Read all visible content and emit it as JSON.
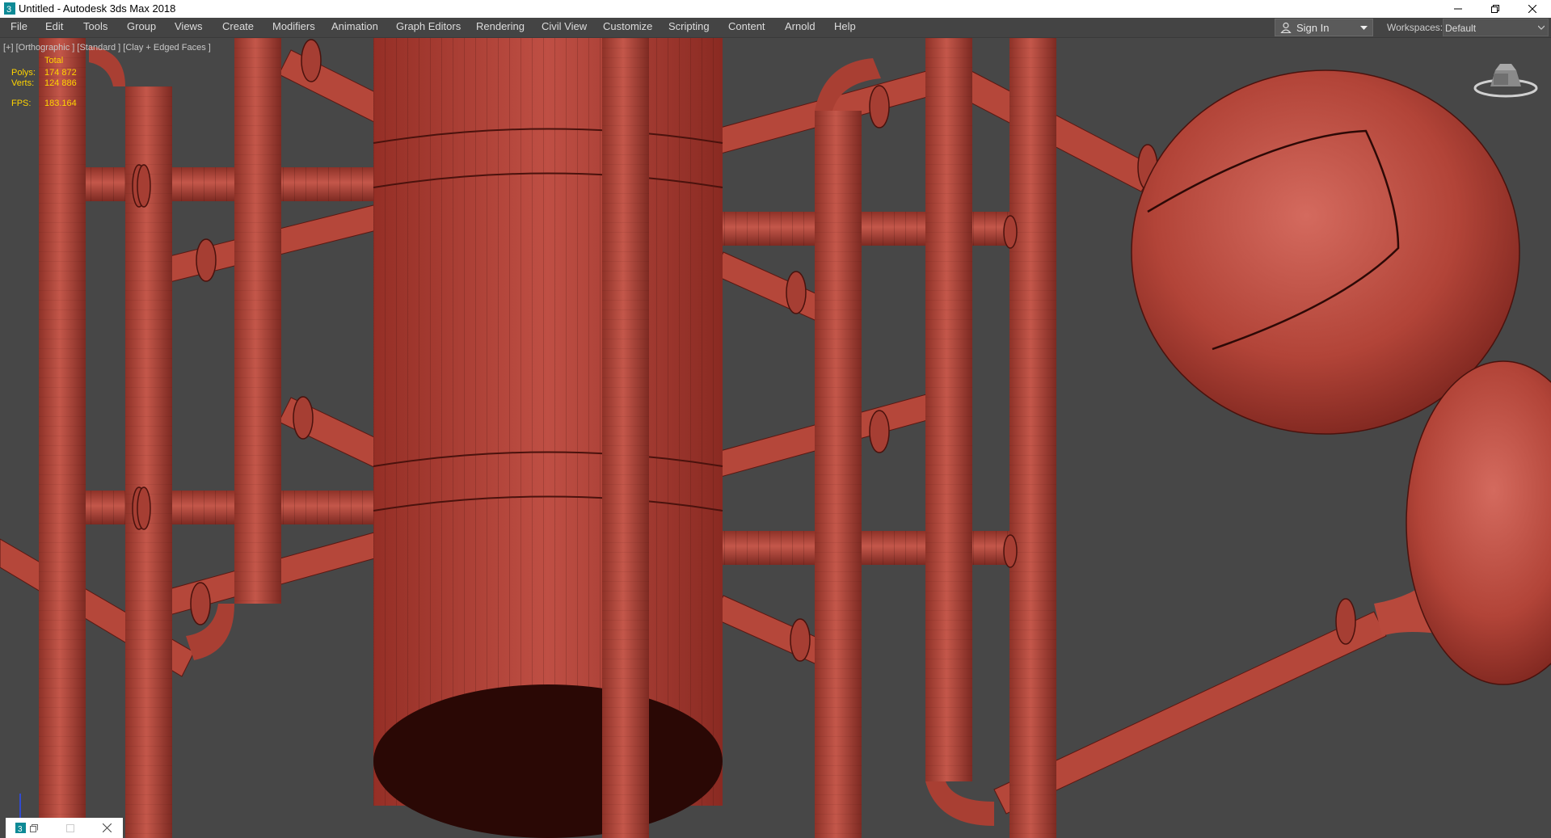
{
  "window": {
    "title": "Untitled - Autodesk 3ds Max 2018",
    "app_icon": "3dsmax-icon",
    "controls": [
      "minimize-icon",
      "restore-icon",
      "close-icon"
    ]
  },
  "menu": [
    {
      "label": "File"
    },
    {
      "label": "Edit"
    },
    {
      "label": "Tools"
    },
    {
      "label": "Group"
    },
    {
      "label": "Views"
    },
    {
      "label": "Create"
    },
    {
      "label": "Modifiers"
    },
    {
      "label": "Animation"
    },
    {
      "label": "Graph Editors"
    },
    {
      "label": "Rendering"
    },
    {
      "label": "Civil View"
    },
    {
      "label": "Customize"
    },
    {
      "label": "Scripting"
    },
    {
      "label": "Content"
    },
    {
      "label": "Arnold"
    },
    {
      "label": "Help"
    }
  ],
  "account": {
    "sign_in_label": "Sign In",
    "icon": "user-icon"
  },
  "workspaces": {
    "label": "Workspaces:",
    "value": "Default"
  },
  "viewport": {
    "label": "[+] [Orthographic ] [Standard ] [Clay + Edged Faces ]",
    "stats": {
      "header": "Total",
      "polys_label": "Polys:",
      "polys_value": "174 872",
      "verts_label": "Verts:",
      "verts_value": "124 886",
      "fps_label": "FPS:",
      "fps_value": "183.164"
    },
    "navigation": "viewcube-icon",
    "axis": "axis-tripod-icon"
  },
  "colors": {
    "ui_dark": "#444444",
    "viewport_bg": "#474747",
    "clay": "#b5473a",
    "stats_text": "#ffd400",
    "title_bar": "#ffffff"
  },
  "minimized_window": {
    "icon": "3dsmax-icon",
    "controls": [
      "restore-icon",
      "maximize-icon",
      "close-icon"
    ]
  }
}
